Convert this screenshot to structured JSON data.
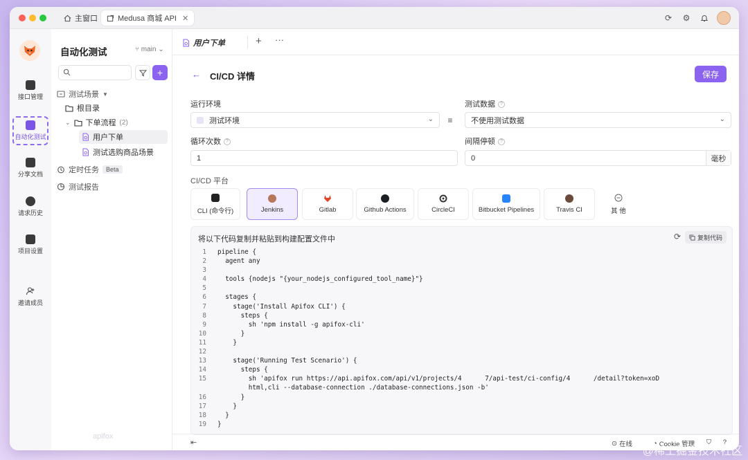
{
  "window": {
    "tabs": [
      {
        "label": "主窗口",
        "icon": "home-icon"
      },
      {
        "label": "Medusa 商城 API",
        "icon": "external-link-icon"
      }
    ],
    "traffic_colors": [
      "#fe5f57",
      "#febc2e",
      "#28c840"
    ]
  },
  "rail": {
    "items": [
      {
        "label": "接口管理",
        "icon": "api-icon"
      },
      {
        "label": "自动化测试",
        "icon": "automation-icon",
        "active": true
      },
      {
        "label": "分享文档",
        "icon": "document-icon"
      },
      {
        "label": "请求历史",
        "icon": "history-icon"
      },
      {
        "label": "项目设置",
        "icon": "settings-icon"
      },
      {
        "label": "邀请成员",
        "icon": "invite-icon"
      }
    ]
  },
  "tree": {
    "title": "自动化测试",
    "branch": "main",
    "nodes": [
      {
        "label": "测试场景",
        "icon": "scenario-icon"
      },
      {
        "label": "根目录",
        "icon": "folder-icon"
      },
      {
        "label": "下单流程",
        "count": "(2)",
        "icon": "folder-icon"
      },
      {
        "label": "用户下单",
        "icon": "scenario-file-icon",
        "selected": true
      },
      {
        "label": "测试选购商品场景",
        "icon": "scenario-file-icon"
      },
      {
        "label": "定时任务",
        "badge": "Beta",
        "icon": "timer-icon"
      },
      {
        "label": "测试报告",
        "icon": "report-icon"
      }
    ],
    "footer": "apifox"
  },
  "main": {
    "tab_label": "用户下单",
    "page_title": "CI/CD 详情",
    "save_label": "保存",
    "env_label": "运行环境",
    "env_value": "测试环境",
    "data_label": "测试数据",
    "data_value": "不使用测试数据",
    "loop_label": "循环次数",
    "loop_value": "1",
    "interval_label": "间隔停顿",
    "interval_value": "0",
    "interval_unit": "毫秒",
    "platform_label": "CI/CD 平台",
    "platforms": [
      {
        "label": "CLI (命令行)",
        "color": "#222222"
      },
      {
        "label": "Jenkins",
        "color": "#b7775b",
        "active": true
      },
      {
        "label": "Gitlab",
        "color": "#e24329"
      },
      {
        "label": "Github Actions",
        "color": "#1b1f23"
      },
      {
        "label": "CircleCI",
        "color": "#343434"
      },
      {
        "label": "Bitbucket Pipelines",
        "color": "#2684ff"
      },
      {
        "label": "Travis CI",
        "color": "#6b4a3a"
      },
      {
        "label": "其 他",
        "color": "#666666"
      }
    ],
    "code_header": "将以下代码复制并粘贴到构建配置文件中",
    "copy_label": "复制代码",
    "code_lines": [
      {
        "n": "1",
        "t": "pipeline {"
      },
      {
        "n": "2",
        "t": "  agent any"
      },
      {
        "n": "3",
        "t": ""
      },
      {
        "n": "4",
        "t": "  tools {nodejs \"{your_nodejs_configured_tool_name}\"}"
      },
      {
        "n": "5",
        "t": ""
      },
      {
        "n": "6",
        "t": "  stages {"
      },
      {
        "n": "7",
        "t": "    stage('Install Apifox CLI') {"
      },
      {
        "n": "8",
        "t": "      steps {"
      },
      {
        "n": "9",
        "t": "        sh 'npm install -g apifox-cli'"
      },
      {
        "n": "10",
        "t": "      }"
      },
      {
        "n": "11",
        "t": "    }"
      },
      {
        "n": "12",
        "t": ""
      },
      {
        "n": "13",
        "t": "    stage('Running Test Scenario') {"
      },
      {
        "n": "14",
        "t": "      steps {"
      },
      {
        "n": "15",
        "t": "        sh 'apifox run https://api.apifox.com/api/v1/projects/4      7/api-test/ci-config/4      /detail?token=xoD                        c -r"
      },
      {
        "n": "",
        "t": "        html,cli --database-connection ./database-connections.json -b'"
      },
      {
        "n": "16",
        "t": "      }"
      },
      {
        "n": "17",
        "t": "    }"
      },
      {
        "n": "18",
        "t": "  }"
      },
      {
        "n": "19",
        "t": "}"
      }
    ]
  },
  "status": {
    "online": "在线",
    "cookie": "Cookie 管理"
  },
  "accent": "#8b63f0"
}
